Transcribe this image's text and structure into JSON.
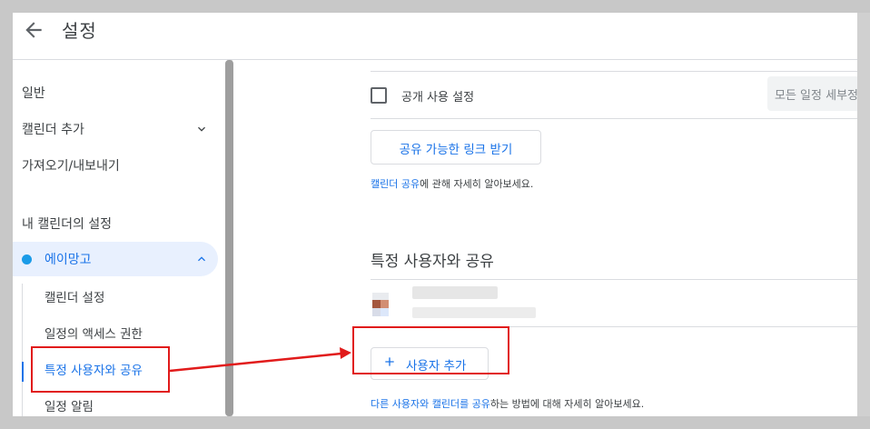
{
  "header": {
    "back_icon": "arrow-left-icon",
    "title": "설정"
  },
  "sidebar": {
    "general": "일반",
    "add_calendar": "캘린더 추가",
    "import_export": "가져오기/내보내기",
    "my_calendars_heading": "내 캘린더의 설정",
    "calendar": {
      "name": "에이망고",
      "color": "#1a9be8"
    },
    "sub_items": [
      {
        "label": "캘린더 설정"
      },
      {
        "label": "일정의 액세스 권한"
      },
      {
        "label": "특정 사용자와 공유"
      },
      {
        "label": "일정 알림"
      }
    ]
  },
  "main": {
    "public_setting_label": "공개 사용 설정",
    "public_setting_checked": false,
    "visibility_select_value": "모든 일정 세부정보",
    "shareable_link_button": "공유 가능한 링크 받기",
    "help_calendar_sharing_link": "캘린더 공유",
    "help_calendar_sharing_rest": "에 관해 자세히 알아보세요.",
    "share_section_title": "특정 사용자와 공유",
    "add_user_button": "사용자 추가",
    "help2_link1": "다른 사용자와 캘린더를 공유",
    "help2_rest": "하는 방법에 대해 자세히 알아보세요."
  },
  "colors": {
    "accent": "#1a73e8",
    "annotation": "#e11b1b",
    "active_item_bg": "#e8f0fe"
  }
}
